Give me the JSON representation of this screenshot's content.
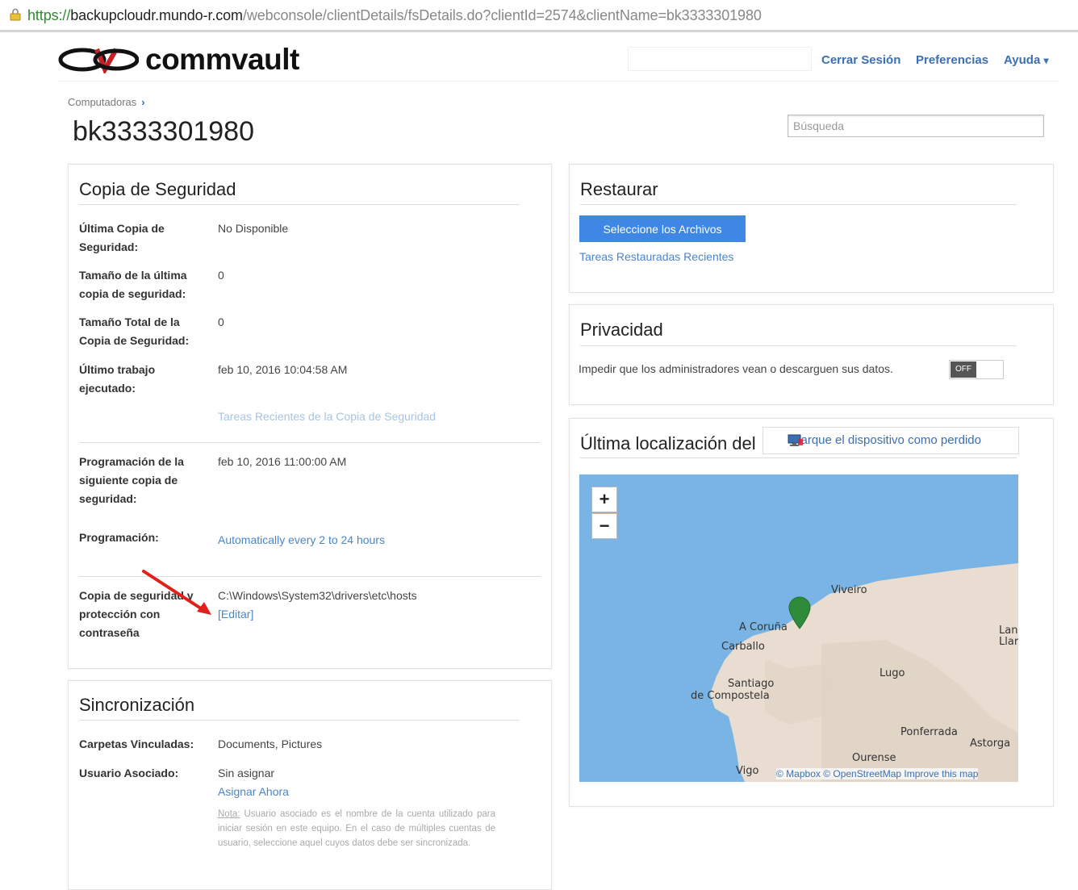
{
  "browser": {
    "url_protocol": "https://",
    "url_host": "backupcloudr.mundo-r.com",
    "url_path": "/webconsole/clientDetails/fsDetails.do?clientId=2574&clientName=bk3333301980",
    "lock_icon": "lock-icon"
  },
  "header": {
    "logo_text": "commvault",
    "links": {
      "logout": "Cerrar Sesión",
      "preferences": "Preferencias",
      "help": "Ayuda"
    },
    "help_caret": "▾"
  },
  "breadcrumb": {
    "label": "Computadoras",
    "chevron": "›"
  },
  "page_title": "bk3333301980",
  "search": {
    "placeholder": "Búsqueda"
  },
  "backup": {
    "title": "Copia de Seguridad",
    "last_backup_label": "Última Copia de Seguridad:",
    "last_backup_value": "No Disponible",
    "last_size_label": "Tamaño de la última copia de seguridad:",
    "last_size_value": "0",
    "total_size_label": "Tamaño Total de la Copia de Seguridad:",
    "total_size_value": "0",
    "last_job_label": "Último trabajo ejecutado:",
    "last_job_value": "feb 10, 2016 10:04:58 AM",
    "recent_jobs_link": "Tareas Recientes de la Copia de Seguridad",
    "next_label": "Programación de la siguiente copia de seguridad:",
    "next_value": "feb 10, 2016 11:00:00 AM",
    "schedule_label": "Programación:",
    "schedule_value": "Automatically every 2 to 24 hours",
    "protect_label": "Copia de seguridad y protección con contraseña",
    "protect_value": "C:\\Windows\\System32\\drivers\\etc\\hosts",
    "edit_link": "[Editar]"
  },
  "sync": {
    "title": "Sincronización",
    "folders_label": "Carpetas Vinculadas:",
    "folders_value": "Documents, Pictures",
    "user_label": "Usuario Asociado:",
    "user_value": "Sin asignar",
    "assign_link": "Asignar Ahora",
    "note_label": "Nota:",
    "note_text": "Usuario asociado es el nombre de la cuenta utilizado para iniciar sesión en este equipo. En el caso de múltiples cuentas de usuario, seleccione aquel cuyos datos debe ser sincronizada."
  },
  "restore": {
    "title": "Restaurar",
    "button": "Seleccione los Archivos",
    "recent_link": "Tareas Restauradas Recientes"
  },
  "privacy": {
    "title": "Privacidad",
    "text": "Impedir que los administradores vean o descarguen sus datos.",
    "toggle_state": "OFF"
  },
  "location": {
    "title": "Última localización del",
    "lost_button": "Marque el dispositivo como perdido",
    "zoom_in": "+",
    "zoom_out": "−",
    "places": {
      "viveiro": "Viveiro",
      "coruna": "A Coruña",
      "carballo": "Carballo",
      "lugo": "Lugo",
      "santiago1": "Santiago",
      "santiago2": "de Compostela",
      "ponferrada": "Ponferrada",
      "astorga": "Astorga",
      "ourense": "Ourense",
      "vigo": "Vigo",
      "lan1": "Lan",
      "lan2": "Llar"
    },
    "attribution": "© Mapbox © OpenStreetMap Improve this map",
    "marker_color": "#2e8b3a",
    "sea_color": "#79b4e4",
    "land_color": "#e8ddd0"
  }
}
